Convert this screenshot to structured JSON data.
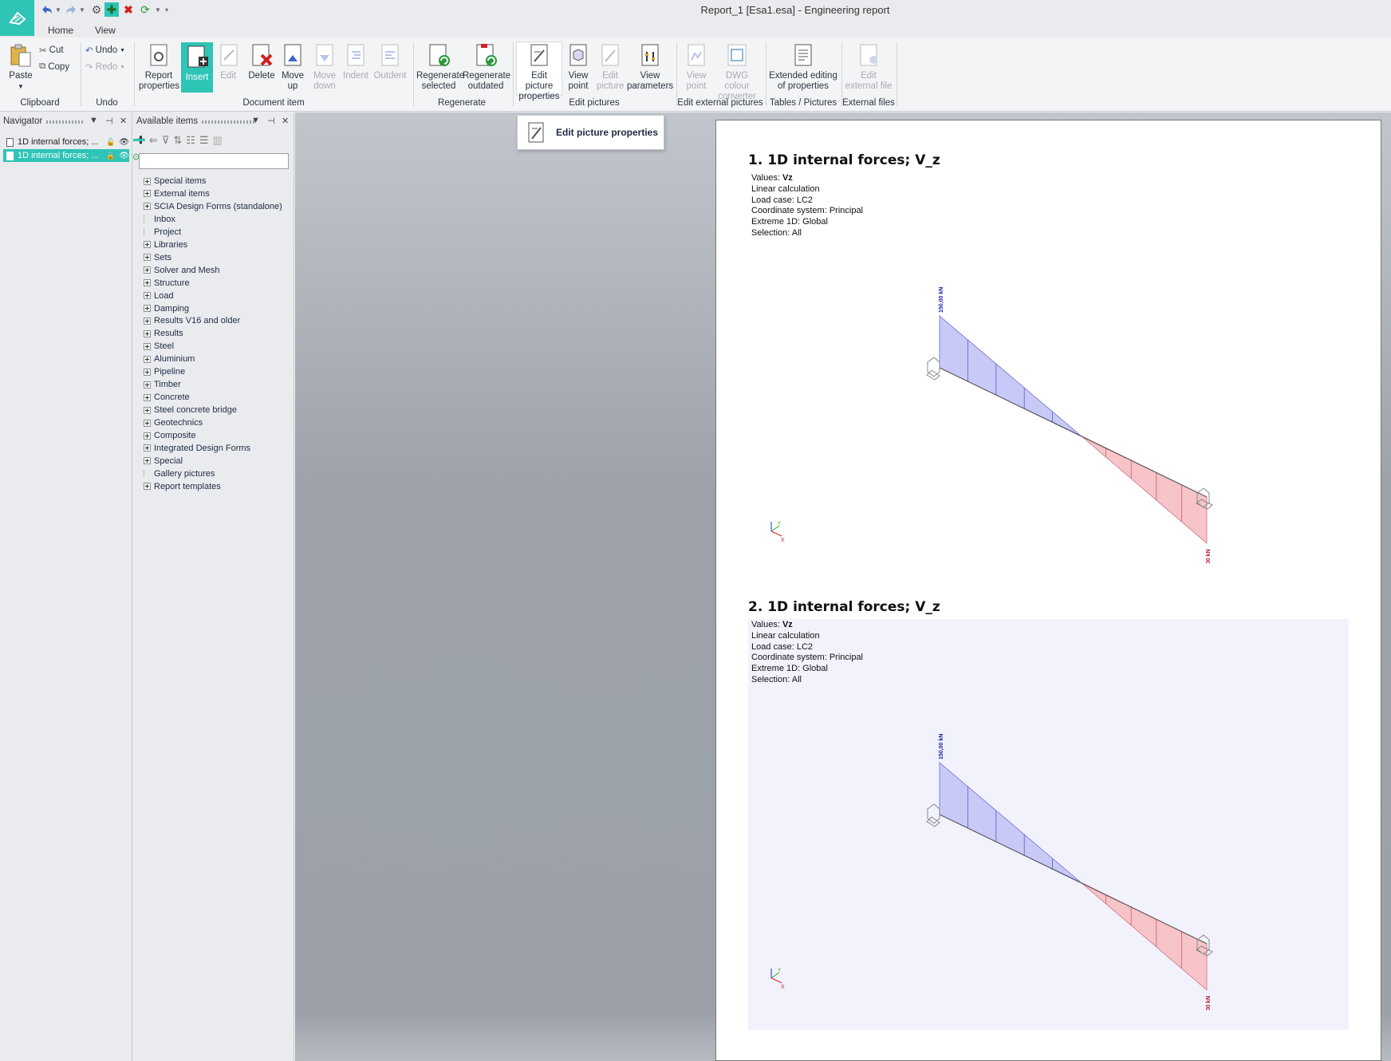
{
  "app": {
    "title": "Report_1 [Esa1.esa] - Engineering report"
  },
  "quick_access": {
    "icons": [
      "undo-icon",
      "redo-icon",
      "settings-icon",
      "insert-icon",
      "close-red-icon",
      "regenerate-icon"
    ]
  },
  "menu": {
    "tabs": [
      "Home",
      "View"
    ]
  },
  "ribbon": {
    "clipboard": {
      "paste": "Paste",
      "cut": "Cut",
      "copy": "Copy",
      "group": "Clipboard"
    },
    "undo": {
      "undo": "Undo",
      "redo": "Redo",
      "group": "Undo"
    },
    "document_item": {
      "report_properties": "Report properties",
      "insert": "Insert",
      "edit": "Edit",
      "delete": "Delete",
      "move_up": "Move up",
      "move_down": "Move down",
      "indent": "Indent",
      "outdent": "Outdent",
      "group": "Document item"
    },
    "regenerate": {
      "selected": "Regenerate selected",
      "outdated": "Regenerate outdated",
      "group": "Regenerate"
    },
    "edit_pictures": {
      "edit_picture_properties": "Edit picture properties",
      "view_point": "View point",
      "edit_picture": "Edit picture",
      "view_parameters": "View parameters",
      "group": "Edit pictures"
    },
    "edit_external": {
      "view_point": "View point",
      "dwg": "DWG colour converter",
      "group": "Edit external pictures"
    },
    "tables": {
      "extended": "Extended editing of properties",
      "group": "Tables / Pictures"
    },
    "external_files": {
      "edit": "Edit external file",
      "group": "External files"
    }
  },
  "tooltip": {
    "text": "Edit picture properties"
  },
  "navigator": {
    "title": "Navigator",
    "items": [
      "1D internal forces; ...",
      "1D internal forces; ..."
    ]
  },
  "available": {
    "title": "Available items",
    "search_placeholder": "",
    "tree": [
      {
        "label": "Special items",
        "expand": true
      },
      {
        "label": "External items",
        "expand": true
      },
      {
        "label": "SCIA Design Forms (standalone)",
        "expand": true
      },
      {
        "label": "Inbox",
        "expand": false
      },
      {
        "label": "Project",
        "expand": false
      },
      {
        "label": "Libraries",
        "expand": true
      },
      {
        "label": "Sets",
        "expand": true
      },
      {
        "label": "Solver and Mesh",
        "expand": true
      },
      {
        "label": "Structure",
        "expand": true
      },
      {
        "label": "Load",
        "expand": true
      },
      {
        "label": "Damping",
        "expand": true
      },
      {
        "label": "Results V16 and older",
        "expand": true
      },
      {
        "label": "Results",
        "expand": true
      },
      {
        "label": "Steel",
        "expand": true
      },
      {
        "label": "Aluminium",
        "expand": true
      },
      {
        "label": "Pipeline",
        "expand": true
      },
      {
        "label": "Timber",
        "expand": true
      },
      {
        "label": "Concrete",
        "expand": true
      },
      {
        "label": "Steel concrete bridge",
        "expand": true
      },
      {
        "label": "Geotechnics",
        "expand": true
      },
      {
        "label": "Composite",
        "expand": true
      },
      {
        "label": "Integrated Design Forms",
        "expand": true
      },
      {
        "label": "Special",
        "expand": true
      },
      {
        "label": "Gallery pictures",
        "expand": false
      },
      {
        "label": "Report templates",
        "expand": true
      }
    ]
  },
  "report": {
    "sections": [
      {
        "title": "1. 1D internal forces; V_z",
        "values_label": "Values:",
        "values_val": "Vz",
        "calc": "Linear calculation",
        "load_case": "Load case: LC2",
        "coord": "Coordinate system: Principal",
        "extreme": "Extreme 1D: Global",
        "selection": "Selection: All",
        "label_top": "150,00 kN",
        "label_bottom": "-150,00 kN",
        "axis_y": "Y",
        "axis_x": "X"
      },
      {
        "title": "2. 1D internal forces; V_z",
        "values_label": "Values:",
        "values_val": "Vz",
        "calc": "Linear calculation",
        "load_case": "Load case: LC2",
        "coord": "Coordinate system: Principal",
        "extreme": "Extreme 1D: Global",
        "selection": "Selection: All",
        "label_top": "150,00 kN",
        "label_bottom": "-150,00 kN",
        "axis_y": "Y",
        "axis_x": "X"
      }
    ]
  },
  "colors": {
    "accent": "#2ec4b6",
    "positive_fill": "#c9c9f7",
    "negative_fill": "#f6c4c9",
    "label_top": "#1a1aa8",
    "label_bottom": "#c0102a"
  }
}
